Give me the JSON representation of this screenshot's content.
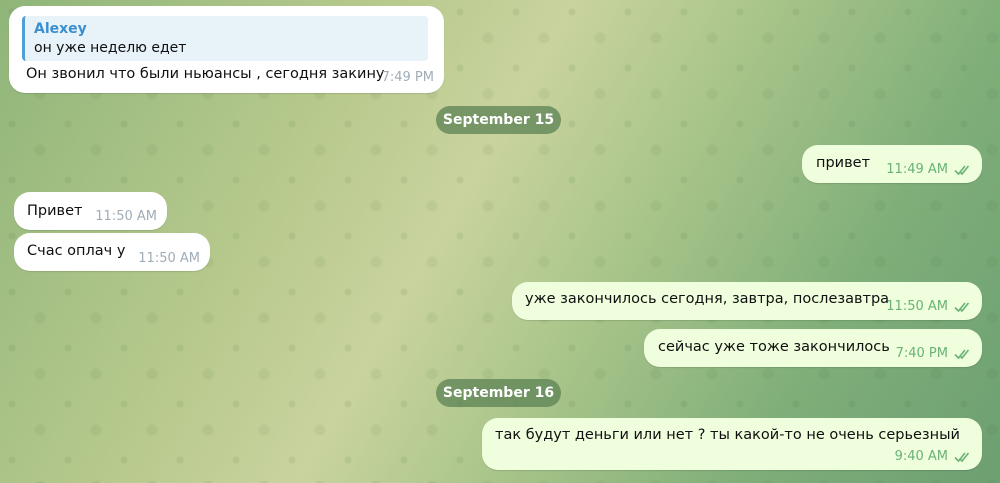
{
  "chat": {
    "messages": [
      {
        "reply": {
          "author": "Alexey",
          "text": "он уже неделю едет"
        },
        "text": "Он звонил что были ньюансы , сегодня закину",
        "time": "7:49 PM",
        "direction": "incoming"
      },
      {
        "date_separator": "September 15"
      },
      {
        "text": "привет",
        "time": "11:49 AM",
        "direction": "outgoing",
        "status": "read"
      },
      {
        "text": "Привет",
        "time": "11:50 AM",
        "direction": "incoming"
      },
      {
        "text": "Счас оплач у",
        "time": "11:50 AM",
        "direction": "incoming"
      },
      {
        "text": "уже закончилось сегодня, завтра, послезавтра",
        "time": "11:50 AM",
        "direction": "outgoing",
        "status": "read"
      },
      {
        "text": "сейчас уже тоже закончилось",
        "time": "7:40 PM",
        "direction": "outgoing",
        "status": "read"
      },
      {
        "date_separator": "September 16"
      },
      {
        "text": "так будут деньги или нет ? ты какой-то не очень серьезный",
        "time": "9:40 AM",
        "direction": "outgoing",
        "status": "read"
      }
    ]
  },
  "colors": {
    "incoming_bubble": "#ffffff",
    "outgoing_bubble": "#effedd",
    "reply_accent": "#4f9fd6",
    "read_check": "#6ab276",
    "date_pill": "#5c8254"
  },
  "icons": {
    "read_status": "double-check-icon"
  }
}
